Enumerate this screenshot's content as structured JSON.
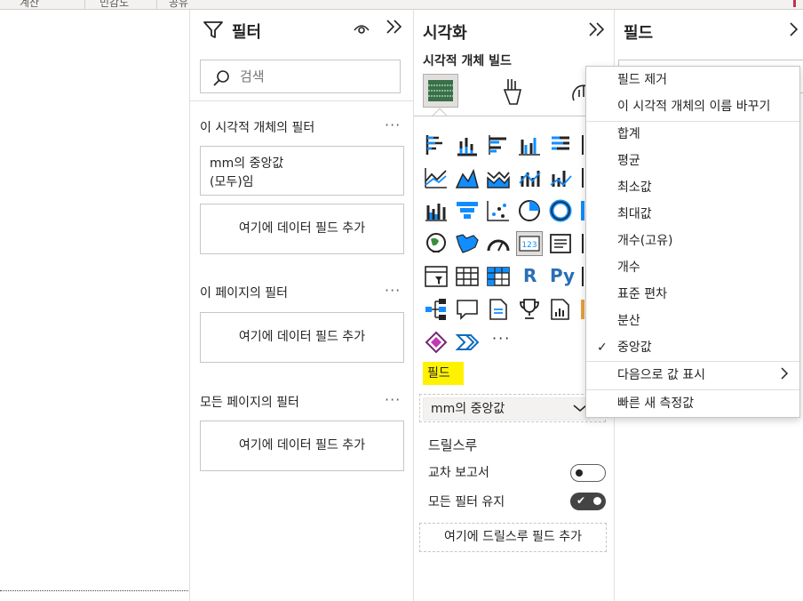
{
  "ribbon": {
    "tabs": [
      "계산",
      "민감도",
      "공유"
    ]
  },
  "filters_pane": {
    "title": "필터",
    "search_placeholder": "검색",
    "sections": [
      {
        "title": "이 시각적 개체의 필터",
        "more": "···"
      },
      {
        "title": "이 페이지의 필터",
        "more": "···"
      },
      {
        "title": "모든 페이지의 필터",
        "more": "···"
      }
    ],
    "visual_filter_card": {
      "line1": "mm의 중앙값",
      "line2": "(모두)임"
    },
    "add_field": "여기에 데이터 필드 추가"
  },
  "viz_pane": {
    "title": "시각화",
    "build_label": "시각적 개체 빌드",
    "more_icons": "···",
    "field_label": "필드",
    "field_value": "mm의 중앙값",
    "drillthrough_label": "드릴스루",
    "cross_report_label": "교차 보고서",
    "cross_report_on": false,
    "keep_filters_label": "모든 필터 유지",
    "keep_filters_on": true,
    "drill_add": "여기에 드릴스루 필드 추가",
    "custom_visual_labels": {
      "r": "R",
      "py": "Py"
    }
  },
  "fields_pane": {
    "title": "필드"
  },
  "context_menu": {
    "items": [
      {
        "label": "필드 제거",
        "checked": false
      },
      {
        "label": "이 시각적 개체의 이름 바꾸기",
        "checked": false
      },
      {
        "label": "합계",
        "checked": false
      },
      {
        "label": "평균",
        "checked": false
      },
      {
        "label": "최소값",
        "checked": false
      },
      {
        "label": "최대값",
        "checked": false
      },
      {
        "label": "개수(고유)",
        "checked": false
      },
      {
        "label": "개수",
        "checked": false
      },
      {
        "label": "표준 편차",
        "checked": false
      },
      {
        "label": "분산",
        "checked": false
      },
      {
        "label": "중앙값",
        "checked": true
      },
      {
        "label": "다음으로 값 표시",
        "checked": false
      },
      {
        "label": "빠른 새 측정값",
        "checked": false
      }
    ]
  },
  "colors": {
    "accent_blue": "#118dff",
    "highlight_yellow": "#fff200",
    "toggle_dark": "#444444"
  }
}
